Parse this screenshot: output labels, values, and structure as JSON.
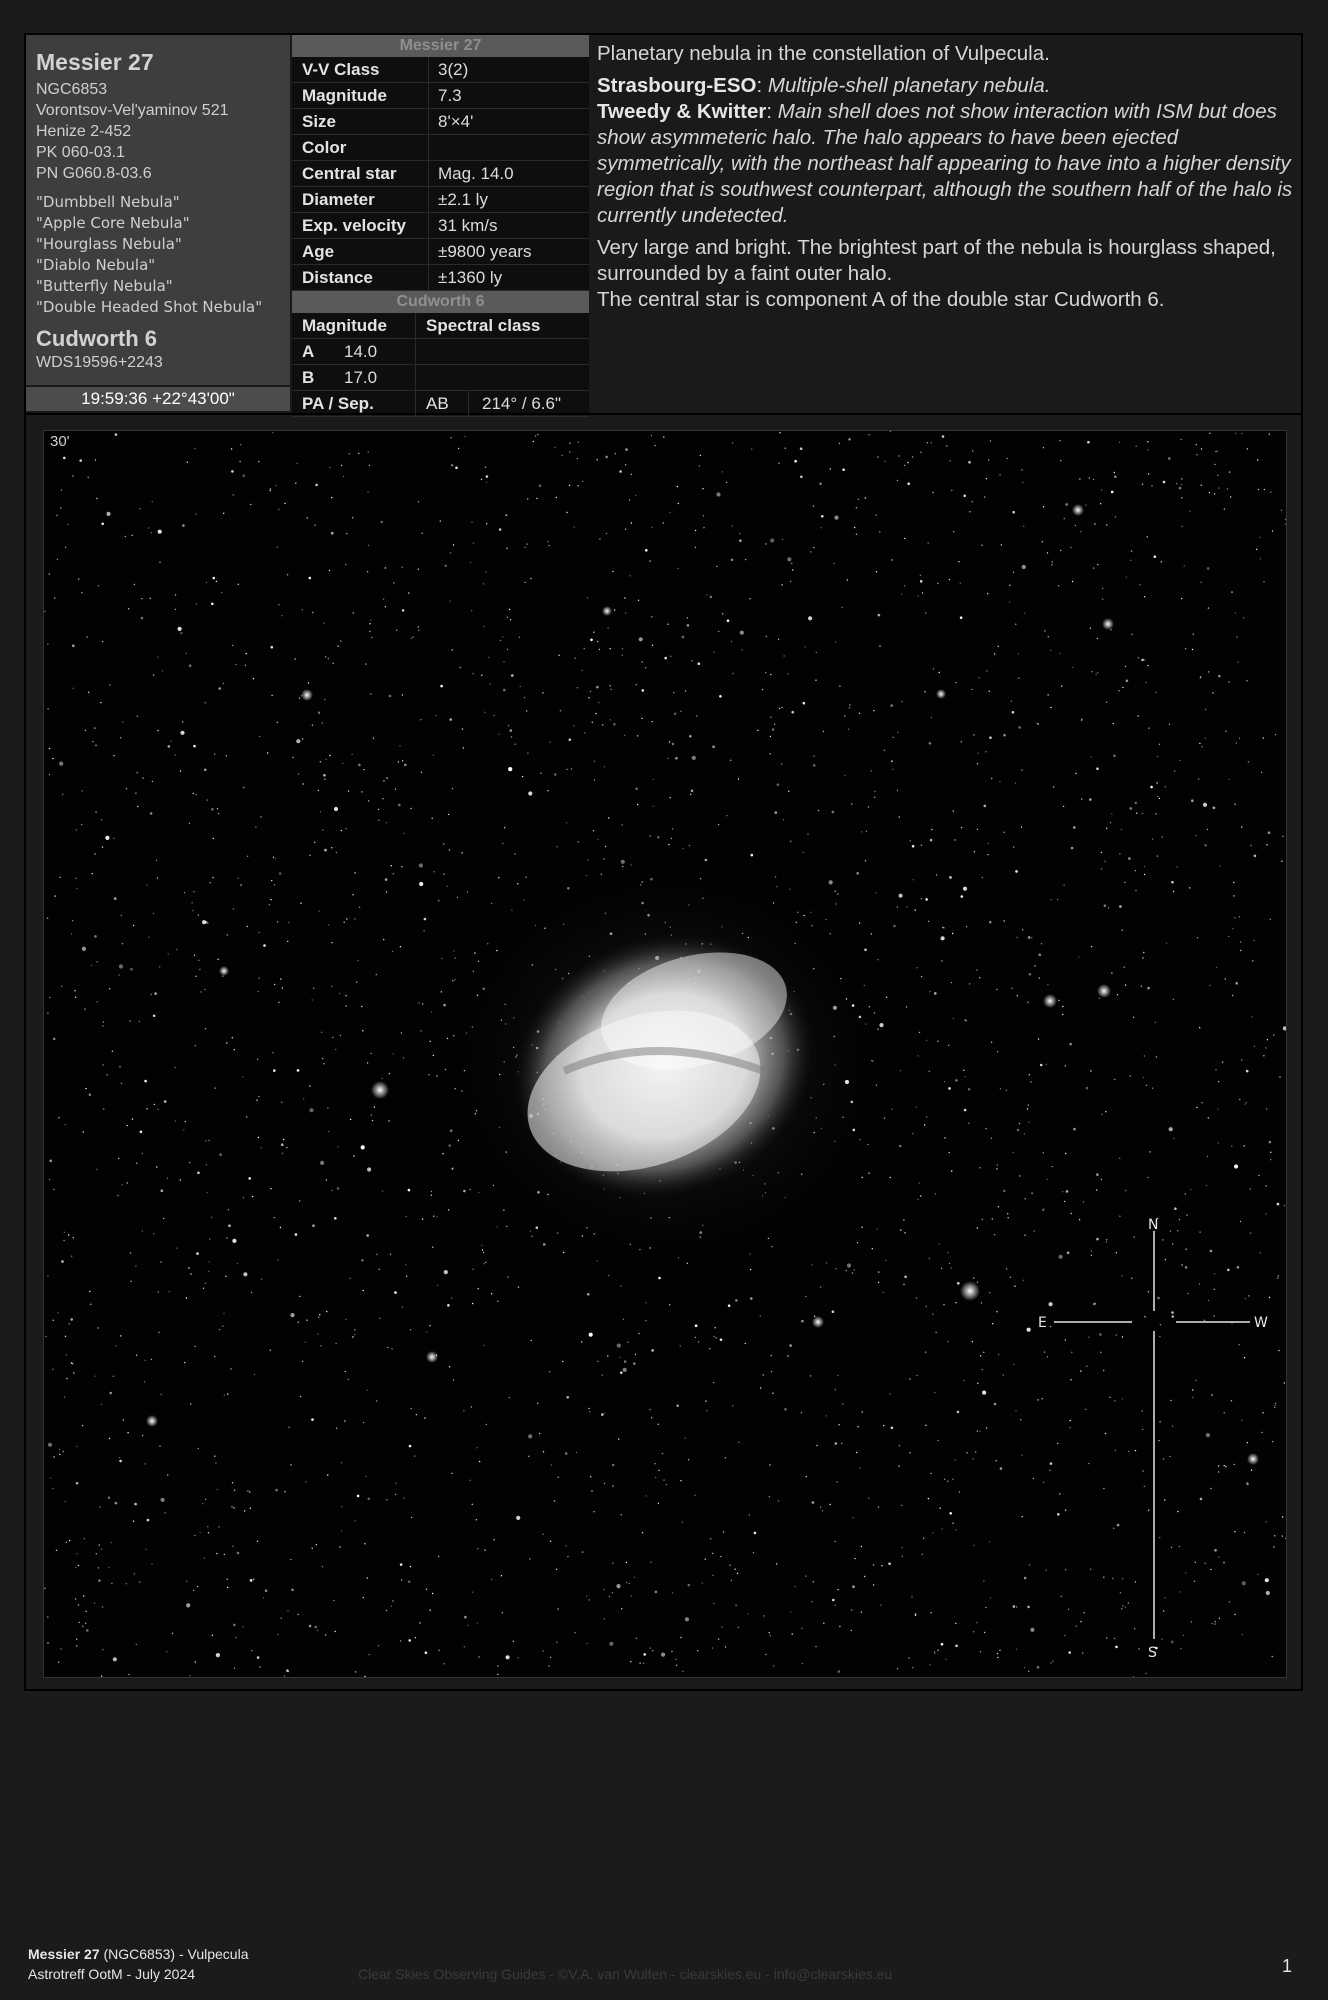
{
  "object": {
    "name": "Messier 27",
    "designations": [
      "NGC6853",
      "Vorontsov-Vel'yaminov 521",
      "Henize 2-452",
      "PK 060-03.1",
      "PN G060.8-03.6"
    ],
    "aliases": [
      "\"Dumbbell Nebula\"",
      "\"Apple Core Nebula\"",
      "\"Hourglass Nebula\"",
      "\"Diablo Nebula\"",
      "\"Butterfly Nebula\"",
      "\"Double Headed Shot Nebula\""
    ],
    "double_star_name": "Cudworth 6",
    "double_star_id": "WDS19596+2243",
    "coordinates": "19:59:36 +22°43'00\""
  },
  "table": {
    "header": "Messier 27",
    "rows": [
      {
        "k": "V-V Class",
        "v": "3(2)"
      },
      {
        "k": "Magnitude",
        "v": "7.3"
      },
      {
        "k": "Size",
        "v": "8'×4'"
      },
      {
        "k": "Color",
        "v": ""
      },
      {
        "k": "Central star",
        "v": "Mag. 14.0"
      },
      {
        "k": "Diameter",
        "v": "±2.1 ly"
      },
      {
        "k": "Exp. velocity",
        "v": "31 km/s"
      },
      {
        "k": "Age",
        "v": "±9800 years"
      },
      {
        "k": "Distance",
        "v": "±1360 ly"
      }
    ],
    "double_header": "Cudworth 6",
    "double_cols": [
      "Magnitude",
      "Spectral class"
    ],
    "components": [
      {
        "id": "A",
        "mag": "14.0",
        "spec": ""
      },
      {
        "id": "B",
        "mag": "17.0",
        "spec": ""
      }
    ],
    "pa_label": "PA / Sep.",
    "pa_pair": "AB",
    "pa_value": "214° / 6.6\""
  },
  "description": {
    "intro": "Planetary nebula in the constellation of Vulpecula.",
    "strasbourg_label": "Strasbourg-ESO",
    "strasbourg_text": "Multiple-shell planetary nebula.",
    "tweedy_label": "Tweedy & Kwitter",
    "tweedy_text": "Main shell does not show interaction with ISM but does show asymmeteric halo. The halo appears to have been ejected symmetrically, with the northeast half appearing to have into a higher density region that is southwest counterpart, although the southern half of the halo is currently undetected.",
    "visual": "Very large and bright. The brightest part of the nebula is hourglass shaped, surrounded by a faint outer halo.",
    "central_star": "The central star is component A of the double star Cudworth 6."
  },
  "image": {
    "scale_label": "30'",
    "compass": {
      "n": "N",
      "s": "S",
      "e": "E",
      "w": "W"
    }
  },
  "footer": {
    "title": "Messier 27",
    "title_rest": "(NGC6853) - Vulpecula",
    "line2": "Astrotreff OotM - July 2024",
    "credit": "Clear Skies Observing Guides - ©V.A. van Wulfen - clearskies.eu - info@clearskies.eu",
    "page": "1"
  }
}
